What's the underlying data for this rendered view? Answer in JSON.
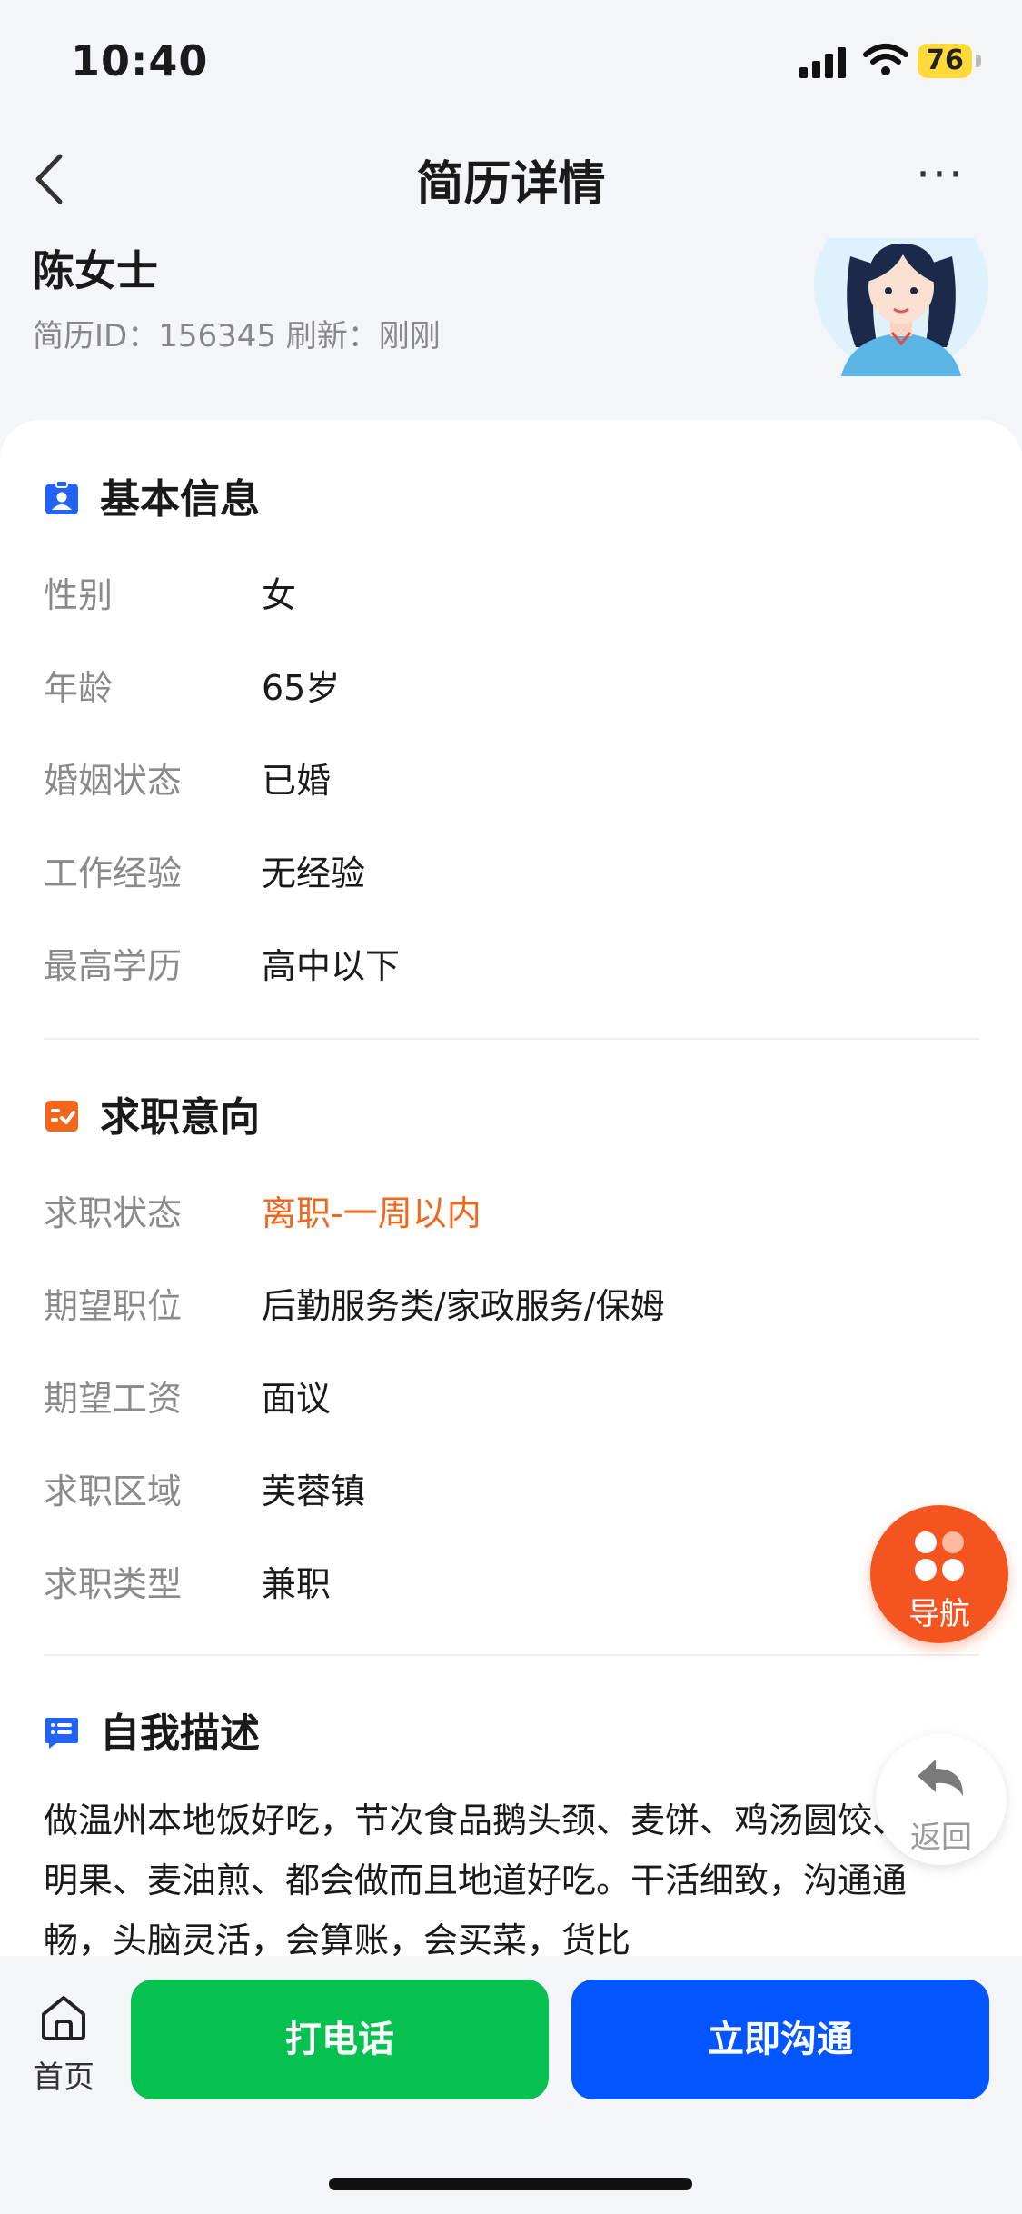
{
  "status_bar": {
    "time": "10:40",
    "battery": "76"
  },
  "nav": {
    "title": "简历详情",
    "more_label": "···"
  },
  "profile": {
    "name": "陈女士",
    "meta": "简历ID：156345   刷新：刚刚"
  },
  "basic_info": {
    "title": "基本信息",
    "rows": [
      {
        "label": "性别",
        "value": "女"
      },
      {
        "label": "年龄",
        "value": "65岁"
      },
      {
        "label": "婚姻状态",
        "value": "已婚"
      },
      {
        "label": "工作经验",
        "value": "无经验"
      },
      {
        "label": "最高学历",
        "value": "高中以下"
      }
    ]
  },
  "job_intent": {
    "title": "求职意向",
    "rows": [
      {
        "label": "求职状态",
        "value": "离职-一周以内"
      },
      {
        "label": "期望职位",
        "value": "后勤服务类/家政服务/保姆"
      },
      {
        "label": "期望工资",
        "value": "面议"
      },
      {
        "label": "求职区域",
        "value": "芙蓉镇"
      },
      {
        "label": "求职类型",
        "value": "兼职"
      }
    ]
  },
  "self_desc": {
    "title": "自我描述",
    "text": "做温州本地饭好吃，节次食品鹅头颈、麦饼、鸡汤圆饺、清明果、麦油煎、都会做而且地道好吃。干活细致，沟通通畅，头脑灵活，会算账，会买菜，货比"
  },
  "fab": {
    "nav_label": "导航",
    "back_label": "返回"
  },
  "bottom": {
    "home_label": "首页",
    "call_label": "打电话",
    "chat_label": "立即沟通"
  },
  "colors": {
    "accent_orange": "#f2671c",
    "call_green": "#06c150",
    "chat_blue": "#0356ff",
    "nav_fab": "#f4541f"
  }
}
